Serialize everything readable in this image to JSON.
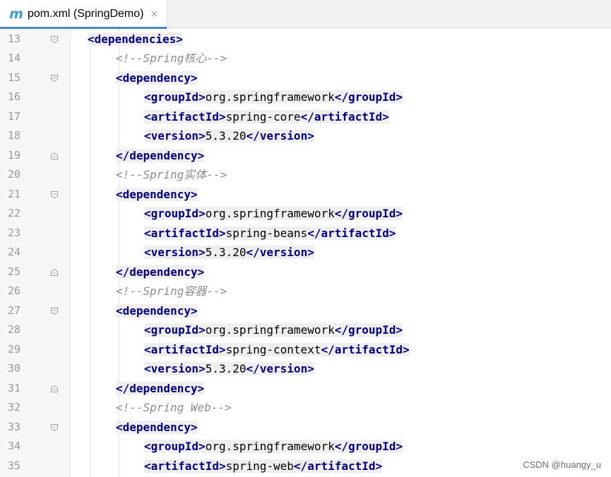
{
  "tab": {
    "icon": "maven-m-icon",
    "icon_glyph": "m",
    "label": "pom.xml (SpringDemo)",
    "close_glyph": "×"
  },
  "lines": [
    {
      "number": "13",
      "indent": 1,
      "fold": "open",
      "parts": [
        {
          "t": "tag",
          "v": "<dependencies>"
        }
      ]
    },
    {
      "number": "14",
      "indent": 2,
      "fold": "",
      "parts": [
        {
          "t": "comment",
          "v": "<!--Spring核心-->"
        }
      ]
    },
    {
      "number": "15",
      "indent": 2,
      "fold": "open",
      "parts": [
        {
          "t": "tag",
          "v": "<dependency>"
        }
      ]
    },
    {
      "number": "16",
      "indent": 3,
      "fold": "",
      "parts": [
        {
          "t": "tag",
          "v": "<groupId>"
        },
        {
          "t": "txt",
          "v": "org.springframework"
        },
        {
          "t": "tag",
          "v": "</groupId>"
        }
      ]
    },
    {
      "number": "17",
      "indent": 3,
      "fold": "",
      "parts": [
        {
          "t": "tag",
          "v": "<artifactId>"
        },
        {
          "t": "txt",
          "v": "spring-core"
        },
        {
          "t": "tag",
          "v": "</artifactId>"
        }
      ]
    },
    {
      "number": "18",
      "indent": 3,
      "fold": "",
      "parts": [
        {
          "t": "tag",
          "v": "<version>"
        },
        {
          "t": "txt",
          "v": "5.3.20"
        },
        {
          "t": "tag",
          "v": "</version>"
        }
      ]
    },
    {
      "number": "19",
      "indent": 2,
      "fold": "close",
      "parts": [
        {
          "t": "tag",
          "v": "</dependency>"
        }
      ]
    },
    {
      "number": "20",
      "indent": 2,
      "fold": "",
      "parts": [
        {
          "t": "comment",
          "v": "<!--Spring实体-->"
        }
      ]
    },
    {
      "number": "21",
      "indent": 2,
      "fold": "open",
      "parts": [
        {
          "t": "tag",
          "v": "<dependency>"
        }
      ]
    },
    {
      "number": "22",
      "indent": 3,
      "fold": "",
      "parts": [
        {
          "t": "tag",
          "v": "<groupId>"
        },
        {
          "t": "txt",
          "v": "org.springframework"
        },
        {
          "t": "tag",
          "v": "</groupId>"
        }
      ]
    },
    {
      "number": "23",
      "indent": 3,
      "fold": "",
      "parts": [
        {
          "t": "tag",
          "v": "<artifactId>"
        },
        {
          "t": "txt",
          "v": "spring-beans"
        },
        {
          "t": "tag",
          "v": "</artifactId>"
        }
      ]
    },
    {
      "number": "24",
      "indent": 3,
      "fold": "",
      "parts": [
        {
          "t": "tag",
          "v": "<version>"
        },
        {
          "t": "txt",
          "v": "5.3.20"
        },
        {
          "t": "tag",
          "v": "</version>"
        }
      ]
    },
    {
      "number": "25",
      "indent": 2,
      "fold": "close",
      "parts": [
        {
          "t": "tag",
          "v": "</dependency>"
        }
      ]
    },
    {
      "number": "26",
      "indent": 2,
      "fold": "",
      "parts": [
        {
          "t": "comment",
          "v": "<!--Spring容器-->"
        }
      ]
    },
    {
      "number": "27",
      "indent": 2,
      "fold": "open",
      "parts": [
        {
          "t": "tag",
          "v": "<dependency>"
        }
      ]
    },
    {
      "number": "28",
      "indent": 3,
      "fold": "",
      "parts": [
        {
          "t": "tag",
          "v": "<groupId>"
        },
        {
          "t": "txt",
          "v": "org.springframework"
        },
        {
          "t": "tag",
          "v": "</groupId>"
        }
      ]
    },
    {
      "number": "29",
      "indent": 3,
      "fold": "",
      "parts": [
        {
          "t": "tag",
          "v": "<artifactId>"
        },
        {
          "t": "txt",
          "v": "spring-context"
        },
        {
          "t": "tag",
          "v": "</artifactId>"
        }
      ]
    },
    {
      "number": "30",
      "indent": 3,
      "fold": "",
      "parts": [
        {
          "t": "tag",
          "v": "<version>"
        },
        {
          "t": "txt",
          "v": "5.3.20"
        },
        {
          "t": "tag",
          "v": "</version>"
        }
      ]
    },
    {
      "number": "31",
      "indent": 2,
      "fold": "close",
      "parts": [
        {
          "t": "tag",
          "v": "</dependency>"
        }
      ]
    },
    {
      "number": "32",
      "indent": 2,
      "fold": "",
      "parts": [
        {
          "t": "comment",
          "v": "<!--Spring Web-->"
        }
      ]
    },
    {
      "number": "33",
      "indent": 2,
      "fold": "open",
      "parts": [
        {
          "t": "tag",
          "v": "<dependency>"
        }
      ]
    },
    {
      "number": "34",
      "indent": 3,
      "fold": "",
      "parts": [
        {
          "t": "tag",
          "v": "<groupId>"
        },
        {
          "t": "txt",
          "v": "org.springframework"
        },
        {
          "t": "tag",
          "v": "</groupId>"
        }
      ]
    },
    {
      "number": "35",
      "indent": 3,
      "fold": "",
      "parts": [
        {
          "t": "tag",
          "v": "<artifactId>"
        },
        {
          "t": "txt",
          "v": "spring-web"
        },
        {
          "t": "tag",
          "v": "</artifactId>"
        }
      ]
    }
  ],
  "watermark": "CSDN @huangy_u",
  "colors": {
    "tag": "#000080",
    "comment": "#8c8c8c",
    "text": "#000000",
    "tag_background": "#efefef",
    "tab_accent": "#4a88c7",
    "icon": "#3d9ae0"
  }
}
